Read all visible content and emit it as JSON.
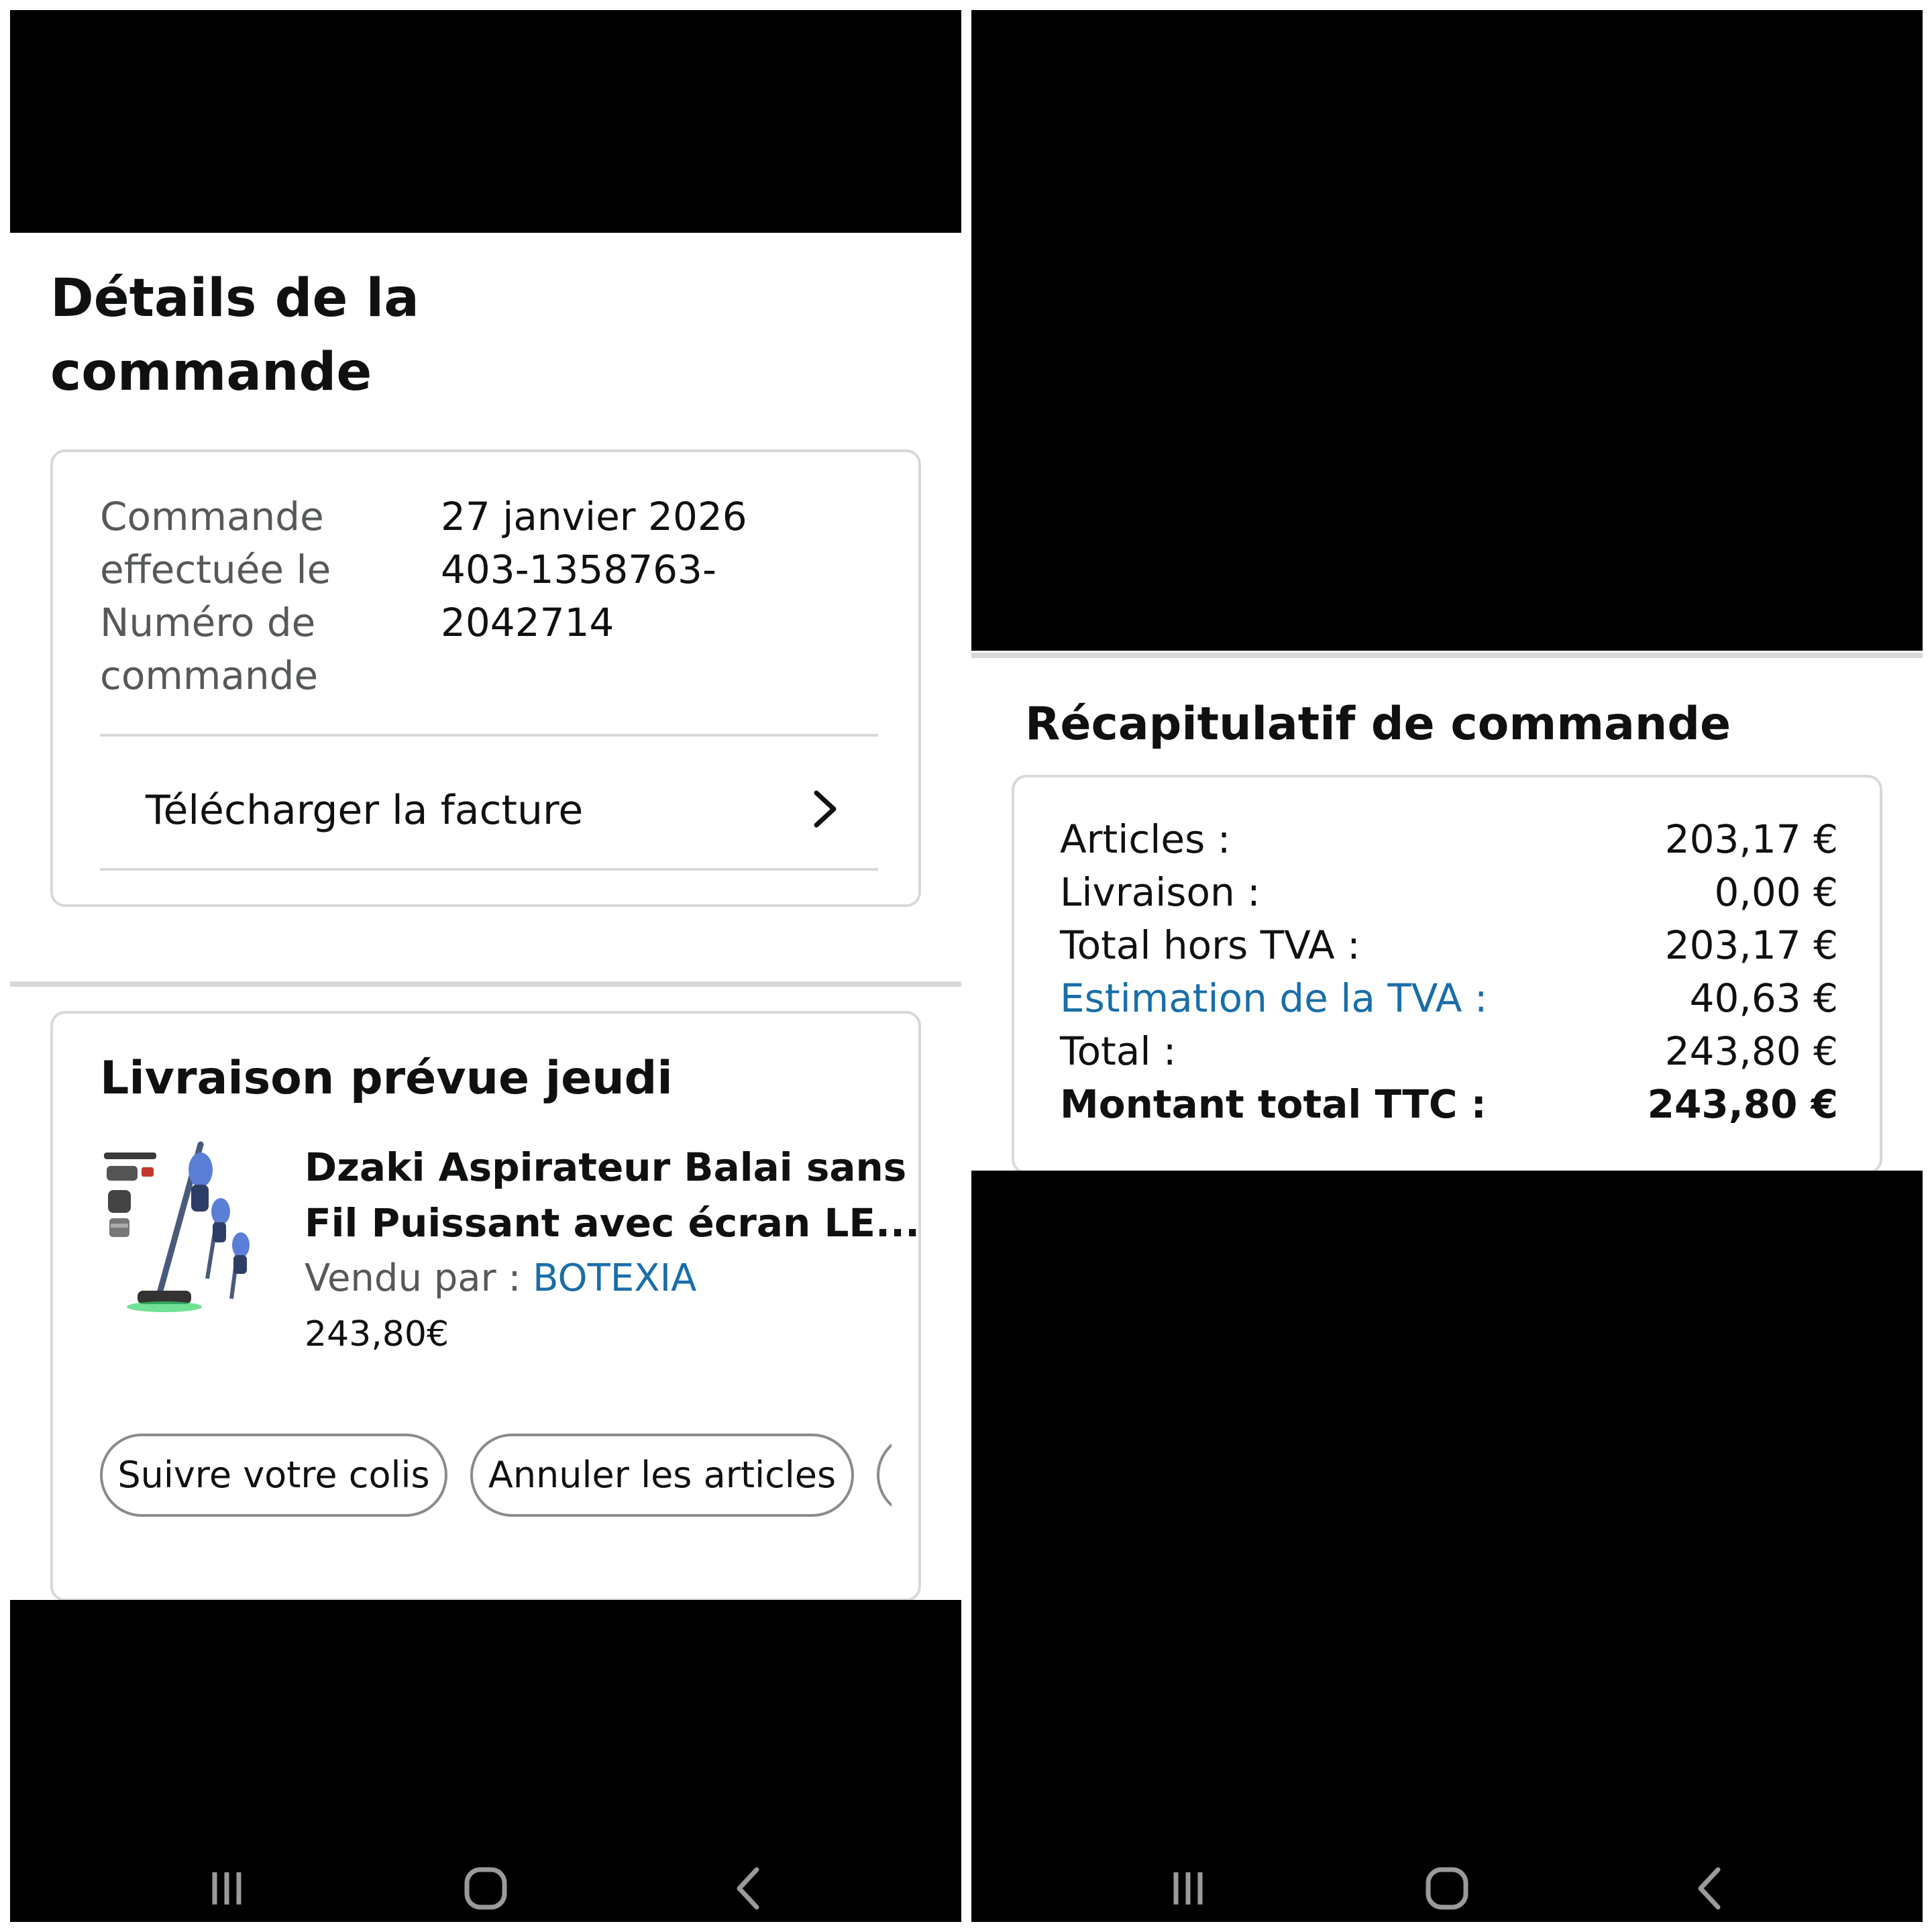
{
  "left_panel": {
    "title_line1": "Détails de la",
    "title_line2": "commande",
    "order_info": {
      "date_label_line1": "Commande",
      "date_label_line2": "effectuée le",
      "number_label_line1": "Numéro de",
      "number_label_line2": "commande",
      "date_value": "27 janvier 2026",
      "number_value_line1": "403-1358763-",
      "number_value_line2": "2042714"
    },
    "invoice_link": "Télécharger la facture",
    "delivery": {
      "title": "Livraison prévue jeudi",
      "product_name_line1": "Dzaki Aspirateur Balai sans",
      "product_name_line2": "Fil Puissant avec écran LE...",
      "seller_label": "Vendu par",
      "seller_sep": " : ",
      "seller_name": "BOTEXIA",
      "price": "243,80€",
      "buttons": {
        "track": "Suivre votre colis",
        "cancel": "Annuler les articles"
      }
    }
  },
  "right_panel": {
    "summary_title": "Récapitulatif de commande",
    "rows": [
      {
        "label": "Articles :",
        "value": "203,17 €"
      },
      {
        "label": "Livraison :",
        "value": "0,00 €"
      },
      {
        "label": "Total hors TVA :",
        "value": "203,17 €"
      },
      {
        "label": "Estimation de la TVA :",
        "value": "40,63 €"
      },
      {
        "label": "Total :",
        "value": "243,80 €"
      },
      {
        "label": "Montant total TTC :",
        "value": "243,80 €"
      }
    ]
  },
  "colors": {
    "link_blue": "#1a6ea8",
    "border_gray": "#d5d9d9",
    "text_dark": "#0f1111",
    "text_secondary": "#565959"
  },
  "icons": {
    "chevron": "chevron-right-icon",
    "nav_recents": "recents-icon",
    "nav_home": "home-icon",
    "nav_back": "back-icon"
  }
}
